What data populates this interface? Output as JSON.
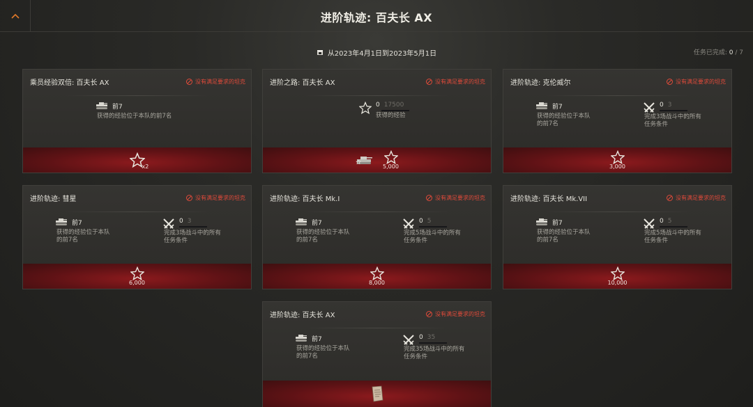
{
  "header": {
    "title": "进阶轨迹: 百夫长 AX",
    "back_icon": "chevron-up-icon"
  },
  "period": {
    "icon": "calendar-icon",
    "text": "从2023年4月1日到2023年5月1日"
  },
  "progress": {
    "label": "任务已完成:",
    "done": "0",
    "separator": "/",
    "total": "7"
  },
  "colors": {
    "warning": "#e04a3a",
    "reward_red": "#8c1a1d",
    "background": "#2a2a27"
  },
  "warning_text": "没有满足要求的坦克",
  "cards": [
    {
      "title": "乘员经验双倍: 百夫长 AX",
      "conditions": [
        {
          "icon": "tank-icon",
          "title": "前7",
          "desc": "获得的经验位于本队的前7名"
        }
      ],
      "rewards": [
        {
          "icon": "crew-star-badge-icon",
          "value": "x2"
        }
      ]
    },
    {
      "title": "进阶之路: 百夫长 AX",
      "conditions": [
        {
          "icon": "star-icon",
          "current": "0",
          "max": "17500",
          "desc": "获得的经验"
        }
      ],
      "rewards": [
        {
          "icon": "tank-reward-icon",
          "value": ""
        },
        {
          "icon": "star-icon",
          "value": "5,000"
        }
      ]
    },
    {
      "title": "进阶轨迹: 克伦威尔",
      "conditions": [
        {
          "icon": "tank-icon",
          "title": "前7",
          "desc": "获得的经验位于本队的前7名"
        },
        {
          "icon": "crossed-swords-icon",
          "current": "0",
          "max": "3",
          "desc": "完成3场战斗中的所有任务条件"
        }
      ],
      "rewards": [
        {
          "icon": "star-icon",
          "value": "3,000"
        }
      ]
    },
    {
      "title": "进阶轨迹: 彗星",
      "conditions": [
        {
          "icon": "tank-icon",
          "title": "前7",
          "desc": "获得的经验位于本队的前7名"
        },
        {
          "icon": "crossed-swords-icon",
          "current": "0",
          "max": "3",
          "desc": "完成3场战斗中的所有任务条件"
        }
      ],
      "rewards": [
        {
          "icon": "star-icon",
          "value": "6,000"
        }
      ]
    },
    {
      "title": "进阶轨迹: 百夫长 Mk.I",
      "conditions": [
        {
          "icon": "tank-icon",
          "title": "前7",
          "desc": "获得的经验位于本队的前7名"
        },
        {
          "icon": "crossed-swords-icon",
          "current": "0",
          "max": "5",
          "desc": "完成5场战斗中的所有任务条件"
        }
      ],
      "rewards": [
        {
          "icon": "star-icon",
          "value": "8,000"
        }
      ]
    },
    {
      "title": "进阶轨迹: 百夫长 Mk.VII",
      "conditions": [
        {
          "icon": "tank-icon",
          "title": "前7",
          "desc": "获得的经验位于本队的前7名"
        },
        {
          "icon": "crossed-swords-icon",
          "current": "0",
          "max": "5",
          "desc": "完成5场战斗中的所有任务条件"
        }
      ],
      "rewards": [
        {
          "icon": "star-icon",
          "value": "10,000"
        }
      ]
    },
    {
      "title": "进阶轨迹: 百夫长 AX",
      "conditions": [
        {
          "icon": "tank-icon",
          "title": "前7",
          "desc": "获得的经验位于本队的前7名"
        },
        {
          "icon": "crossed-swords-icon",
          "current": "0",
          "max": "35",
          "desc": "完成35场战斗中的所有任务条件"
        }
      ],
      "rewards": [
        {
          "icon": "document-scroll-icon",
          "value": ""
        }
      ]
    }
  ]
}
